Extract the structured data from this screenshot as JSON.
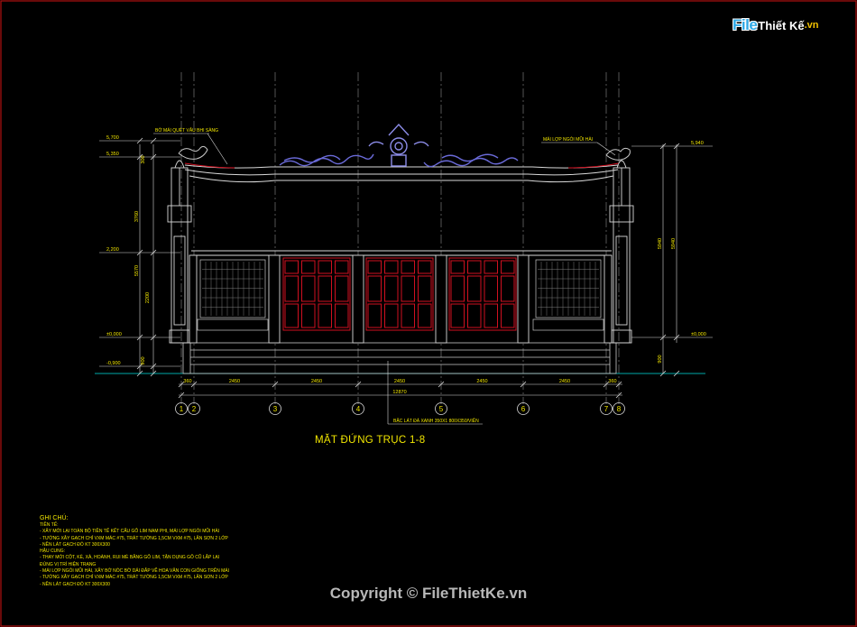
{
  "brand": {
    "logo_file": "File",
    "logo_rest": "Thiết Kế",
    "logo_tld": ".vn",
    "copyright": "Copyright © FileThietKe.vn"
  },
  "drawing": {
    "caption": "MẶT ĐỨNG TRỤC 1-8",
    "labels": {
      "left_callout": "BỜ MÁI QUÉT VÂU BHI SÀNG",
      "right_callout": "MÁI LỢP NGÓI MŨI HÀI",
      "bottom_callout": "BẬC LÁT ĐÁ XANH 350X1 800X350/VIÊN"
    },
    "grid_axes": [
      "1",
      "2",
      "3",
      "4",
      "5",
      "6",
      "7",
      "8"
    ],
    "bay_dims": [
      "360",
      "2450",
      "2450",
      "2450",
      "2450",
      "2450",
      "360"
    ],
    "overall_dim": "12870",
    "left_elevations": [
      "5,700",
      "5,350",
      "2,200",
      "±0,000",
      "-0,900"
    ],
    "right_elevations": [
      "5,940",
      "±0,000"
    ],
    "left_vertical_dims": [
      "300",
      "3760",
      "5570",
      "2200",
      "900"
    ],
    "right_vertical_dims": [
      "5940",
      "5940",
      "900"
    ]
  },
  "notes": {
    "title": "GHI CHÚ:",
    "lines": [
      "TIỀN TẾ:",
      "- XÂY MỚI LẠI TOÀN BỘ TIỀN TẾ KẾT CẤU GỖ LIM NAM PHI, MÁI LỢP NGÓI MŨI HÀI",
      "- TƯỜNG XÂY GẠCH CHỈ VXM MÁC #75, TRÁT TƯỜNG 1,5CM VXM #75, LĂN SƠN 2 LỚP",
      "- NỀN LÁT GẠCH ĐỎ KT 300X300",
      "HẬU CUNG:",
      "- THAY MỚI CỘT, KÈ, XÀ, HOÀNH, RUI MÈ BẰNG GỖ LIM, TẬN DỤNG GỖ CŨ LẮP LẠI",
      "ĐÚNG VỊ TRÍ HIỆN TRẠNG",
      "- MÁI LỢP NGÓI MŨI HÀI, XÂY BỜ NÓC BỜ DẢI ĐẮP VẼ HOA VĂN CON GIỐNG TRÊN MÁI",
      "- TƯỜNG XÂY GẠCH CHỈ VXM MÁC #75, TRÁT TƯỜNG 1,5CM VXM #75, LĂN SƠN 2 LỚP",
      "- NỀN LÁT GẠCH ĐỎ KT 300X300"
    ]
  },
  "colors": {
    "background": "#000000",
    "structure": "#d8d8d8",
    "doors": "#d01020",
    "ornament": "#6a6ad8",
    "dimension": "#d8d8d8",
    "ground": "#00a8a8",
    "text": "#f2e600",
    "frame": "#b01010"
  }
}
